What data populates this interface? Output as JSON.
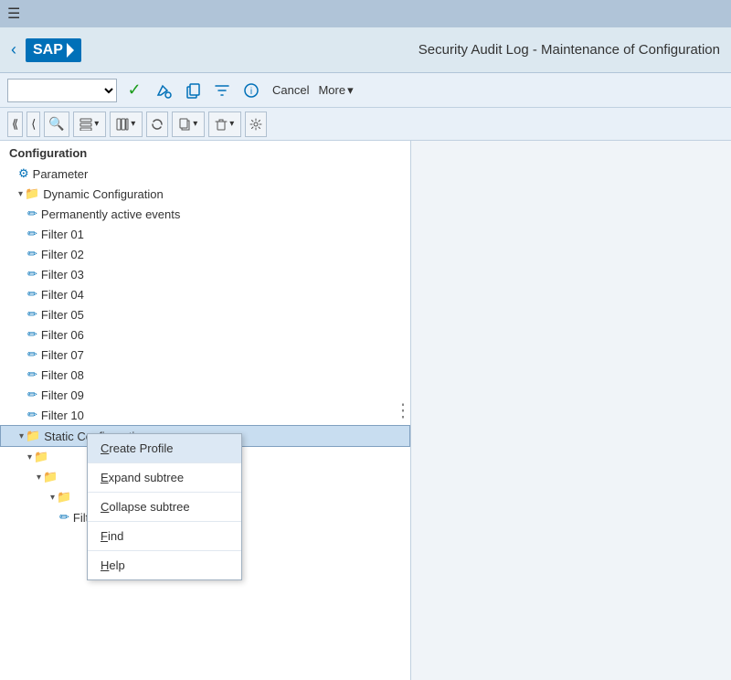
{
  "topbar": {
    "hamburger": "☰"
  },
  "header": {
    "back": "‹",
    "sap_logo": "SAP",
    "title": "Security Audit Log - Maintenance of Configuration"
  },
  "toolbar": {
    "select_placeholder": "",
    "check_icon": "✓",
    "cancel_label": "Cancel",
    "more_label": "More",
    "more_arrow": "▾"
  },
  "toolbar2": {
    "buttons": [
      {
        "label": "⟪",
        "name": "first-page"
      },
      {
        "label": "⟨",
        "name": "prev-page"
      },
      {
        "label": "🔍",
        "name": "search"
      },
      {
        "label": "📋 ▾",
        "name": "layout"
      },
      {
        "label": "⊞ ▾",
        "name": "columns"
      },
      {
        "label": "↺",
        "name": "refresh"
      },
      {
        "label": "📄 ▾",
        "name": "export"
      },
      {
        "label": "🗑 ▾",
        "name": "delete"
      },
      {
        "label": "⚙",
        "name": "settings"
      }
    ]
  },
  "tree": {
    "section_label": "Configuration",
    "items": [
      {
        "id": "parameter",
        "label": "Parameter",
        "indent": "1",
        "icon": "⚙",
        "type": "leaf"
      },
      {
        "id": "dynamic-config",
        "label": "Dynamic Configuration",
        "indent": "1",
        "icon": "📁",
        "type": "expand",
        "expanded": true
      },
      {
        "id": "perm-active",
        "label": "Permanently active events",
        "indent": "2",
        "icon": "✏",
        "type": "leaf"
      },
      {
        "id": "filter01",
        "label": "Filter 01",
        "indent": "2",
        "icon": "✏",
        "type": "leaf"
      },
      {
        "id": "filter02",
        "label": "Filter 02",
        "indent": "2",
        "icon": "✏",
        "type": "leaf"
      },
      {
        "id": "filter03",
        "label": "Filter 03",
        "indent": "2",
        "icon": "✏",
        "type": "leaf"
      },
      {
        "id": "filter04",
        "label": "Filter 04",
        "indent": "2",
        "icon": "✏",
        "type": "leaf"
      },
      {
        "id": "filter05",
        "label": "Filter 05",
        "indent": "2",
        "icon": "✏",
        "type": "leaf"
      },
      {
        "id": "filter06",
        "label": "Filter 06",
        "indent": "2",
        "icon": "✏",
        "type": "leaf"
      },
      {
        "id": "filter07",
        "label": "Filter 07",
        "indent": "2",
        "icon": "✏",
        "type": "leaf"
      },
      {
        "id": "filter08",
        "label": "Filter 08",
        "indent": "2",
        "icon": "✏",
        "type": "leaf"
      },
      {
        "id": "filter09",
        "label": "Filter 09",
        "indent": "2",
        "icon": "✏",
        "type": "leaf"
      },
      {
        "id": "filter10",
        "label": "Filter 10",
        "indent": "2",
        "icon": "✏",
        "type": "leaf"
      },
      {
        "id": "static-config",
        "label": "Static Configuration",
        "indent": "1",
        "icon": "📁",
        "type": "expand",
        "expanded": true,
        "highlighted": true
      },
      {
        "id": "static-sub1",
        "label": "",
        "indent": "2",
        "icon": "📁",
        "type": "expand"
      },
      {
        "id": "static-sub2",
        "label": "",
        "indent": "2",
        "icon": "📁",
        "type": "expand"
      },
      {
        "id": "static-sub3",
        "label": "",
        "indent": "2",
        "icon": "📁",
        "type": "expand"
      },
      {
        "id": "filter-s1",
        "label": "Filter 01",
        "indent": "3",
        "icon": "✏",
        "type": "leaf"
      }
    ]
  },
  "context_menu": {
    "items": [
      {
        "label": "Create Profile",
        "underline_index": 0,
        "underline_char": "C"
      },
      {
        "label": "Expand subtree",
        "underline_index": 0,
        "underline_char": "E"
      },
      {
        "label": "Collapse subtree",
        "underline_index": 0,
        "underline_char": "C"
      },
      {
        "label": "Find",
        "underline_index": 0,
        "underline_char": "F"
      },
      {
        "label": "Help",
        "underline_index": 0,
        "underline_char": "H"
      }
    ]
  }
}
